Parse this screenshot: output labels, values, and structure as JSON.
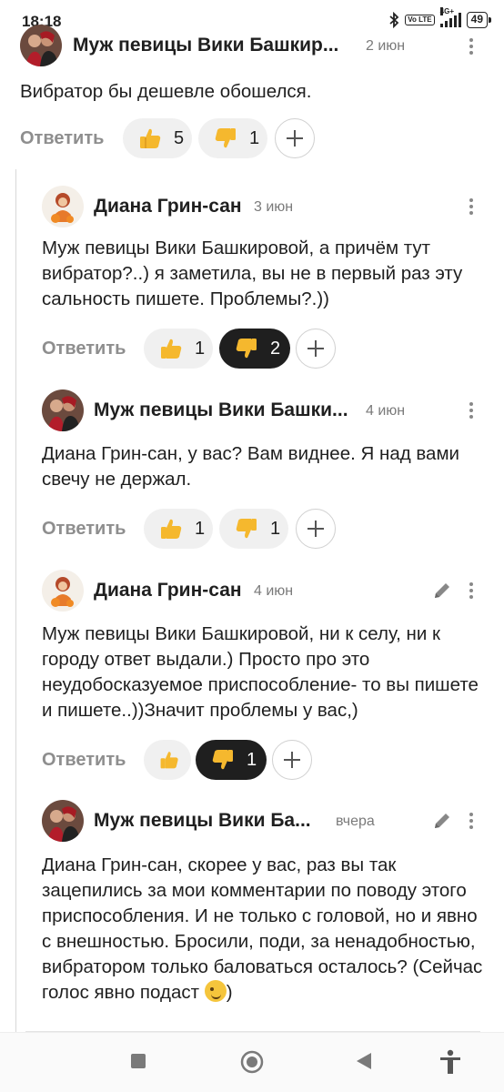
{
  "status_bar": {
    "time": "18:18",
    "lte": "Vo LTE",
    "network": "4G+",
    "battery": "49"
  },
  "comments": [
    {
      "author": "Муж певицы Вики Башкир...",
      "date": "2 июн",
      "text": "Вибратор бы дешевле обошелся.",
      "reply_label": "Ответить",
      "likes": "5",
      "dislikes": "1"
    },
    {
      "author": "Диана Грин-сан",
      "date": "3 июн",
      "text": "Муж певицы Вики Башкировой, а причём тут вибратор?..) я заметила, вы не в первый раз эту сальность пишете. Проблемы?.))",
      "reply_label": "Ответить",
      "likes": "1",
      "dislikes": "2"
    },
    {
      "author": "Муж певицы Вики Башки...",
      "date": "4 июн",
      "text": "Диана Грин-сан, у вас? Вам виднее. Я над вами свечу не держал.",
      "reply_label": "Ответить",
      "likes": "1",
      "dislikes": "1"
    },
    {
      "author": "Диана Грин-сан",
      "date": "4 июн",
      "text": "Муж певицы Вики Башкировой, ни к селу, ни к городу ответ выдали.) Просто про это неудобосказуемое приспособление- то вы пишете и пишете..))Значит проблемы у вас,)",
      "reply_label": "Ответить",
      "likes": "",
      "dislikes": "1"
    },
    {
      "author": "Муж певицы Вики Ба...",
      "date": "вчера",
      "text": "Диана Грин-сан, скорее у вас, раз вы так зацепились за мои комментарии по поводу этого приспособления. И не только с головой, но и явно с внешностью. Бросили, поди, за ненадобностью, вибратором только баловаться осталось? (Сейчас голос явно подаст",
      "text_end": ")"
    }
  ],
  "icons": {
    "thumb_color": "#f5b82e",
    "more": "more-vertical-icon",
    "edit": "pencil-icon"
  }
}
